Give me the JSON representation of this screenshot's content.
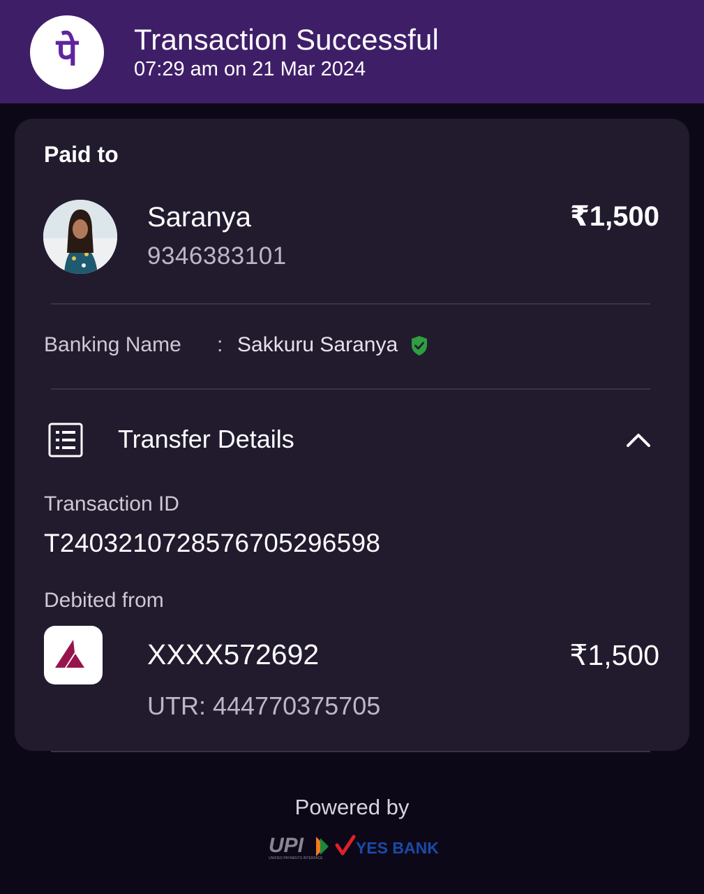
{
  "header": {
    "title": "Transaction Successful",
    "subtitle": "07:29 am on 21 Mar 2024",
    "logo_glyph": "पे",
    "brand_color": "#3f1e68",
    "logo_color": "#5f259f"
  },
  "payee": {
    "section_label": "Paid to",
    "name": "Saranya",
    "phone": "9346383101",
    "amount": "₹1,500"
  },
  "banking": {
    "label": "Banking Name",
    "separator": ":",
    "value": "Sakkuru Saranya",
    "verified_icon": "verified-shield-icon",
    "verified_color": "#2e9e41"
  },
  "transfer": {
    "title": "Transfer Details",
    "icon": "document-list-icon",
    "toggle_icon": "chevron-up-icon",
    "transaction_id_label": "Transaction ID",
    "transaction_id": "T2403210728576705296598",
    "debited_label": "Debited from",
    "account": "XXXX572692",
    "amount": "₹1,500",
    "utr": "UTR: 444770375705",
    "bank_icon": "axis-bank-logo",
    "bank_color": "#97144d"
  },
  "footer": {
    "powered_by": "Powered by",
    "upi_logo_text": "UPI",
    "upi_tagline": "UNIFIED PAYMENTS INTERFACE",
    "bank_logo_text": "YES BANK"
  }
}
